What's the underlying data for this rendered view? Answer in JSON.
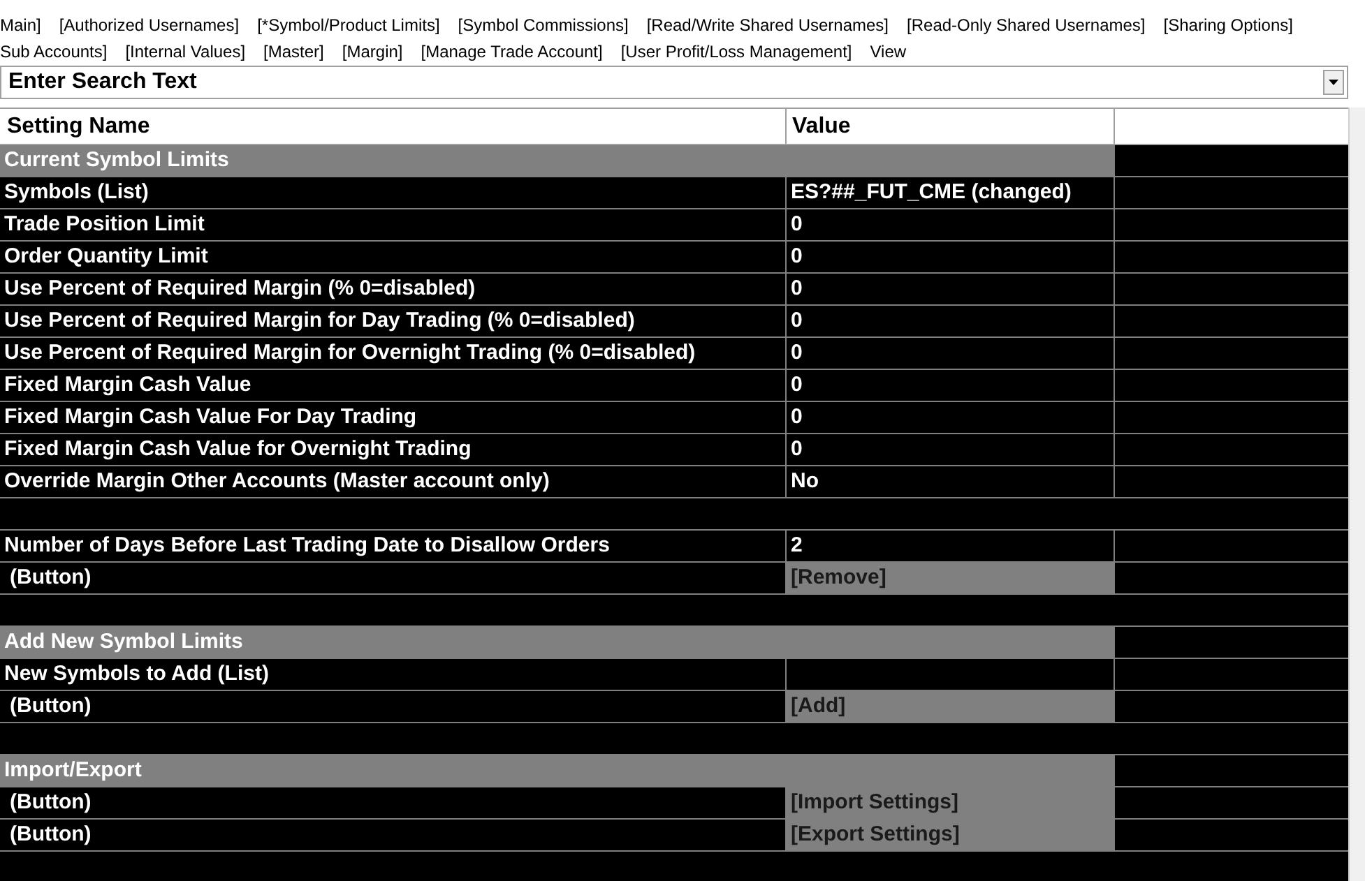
{
  "tab_rows": [
    [
      "Main]",
      "[Authorized Usernames]",
      "[*Symbol/Product Limits]",
      "[Symbol Commissions]",
      "[Read/Write Shared Usernames]",
      "[Read-Only Shared Usernames]",
      "[Sharing Options]"
    ],
    [
      "Sub Accounts]",
      "[Internal Values]",
      "[Master]",
      "[Margin]",
      "[Manage Trade Account]",
      "[User Profit/Loss Management]",
      "View"
    ]
  ],
  "search": {
    "placeholder": "Enter Search Text"
  },
  "table": {
    "columns": [
      "Setting Name",
      "Value"
    ],
    "rows": [
      {
        "kind": "section",
        "name": "Current Symbol Limits"
      },
      {
        "kind": "setting",
        "name": "Symbols (List)",
        "value": "ES?##_FUT_CME (changed)"
      },
      {
        "kind": "setting",
        "name": "Trade Position Limit",
        "value": "0"
      },
      {
        "kind": "setting",
        "name": "Order Quantity Limit",
        "value": "0"
      },
      {
        "kind": "setting",
        "name": "Use Percent of Required Margin (% 0=disabled)",
        "value": "0"
      },
      {
        "kind": "setting",
        "name": "Use Percent of Required Margin for Day Trading (% 0=disabled)",
        "value": "0"
      },
      {
        "kind": "setting",
        "name": "Use Percent of Required Margin for Overnight Trading (% 0=disabled)",
        "value": "0"
      },
      {
        "kind": "setting",
        "name": "Fixed Margin Cash Value",
        "value": "0"
      },
      {
        "kind": "setting",
        "name": "Fixed Margin Cash Value For Day Trading",
        "value": "0"
      },
      {
        "kind": "setting",
        "name": "Fixed Margin Cash Value for Overnight Trading",
        "value": "0"
      },
      {
        "kind": "setting",
        "name": "Override Margin Other Accounts (Master account only)",
        "value": "No"
      },
      {
        "kind": "blank"
      },
      {
        "kind": "setting",
        "name": "Number of Days Before Last Trading Date to Disallow Orders",
        "value": "2"
      },
      {
        "kind": "button",
        "name": "(Button)",
        "value": "[Remove]"
      },
      {
        "kind": "blank"
      },
      {
        "kind": "section",
        "name": "Add New Symbol Limits"
      },
      {
        "kind": "setting",
        "name": "New Symbols to Add (List)"
      },
      {
        "kind": "button",
        "name": "(Button)",
        "value": "[Add]"
      },
      {
        "kind": "blank"
      },
      {
        "kind": "section",
        "name": "Import/Export"
      },
      {
        "kind": "button",
        "name": "(Button)",
        "value": "[Import Settings]"
      },
      {
        "kind": "button",
        "name": "(Button)",
        "value": "[Export Settings]"
      }
    ]
  }
}
